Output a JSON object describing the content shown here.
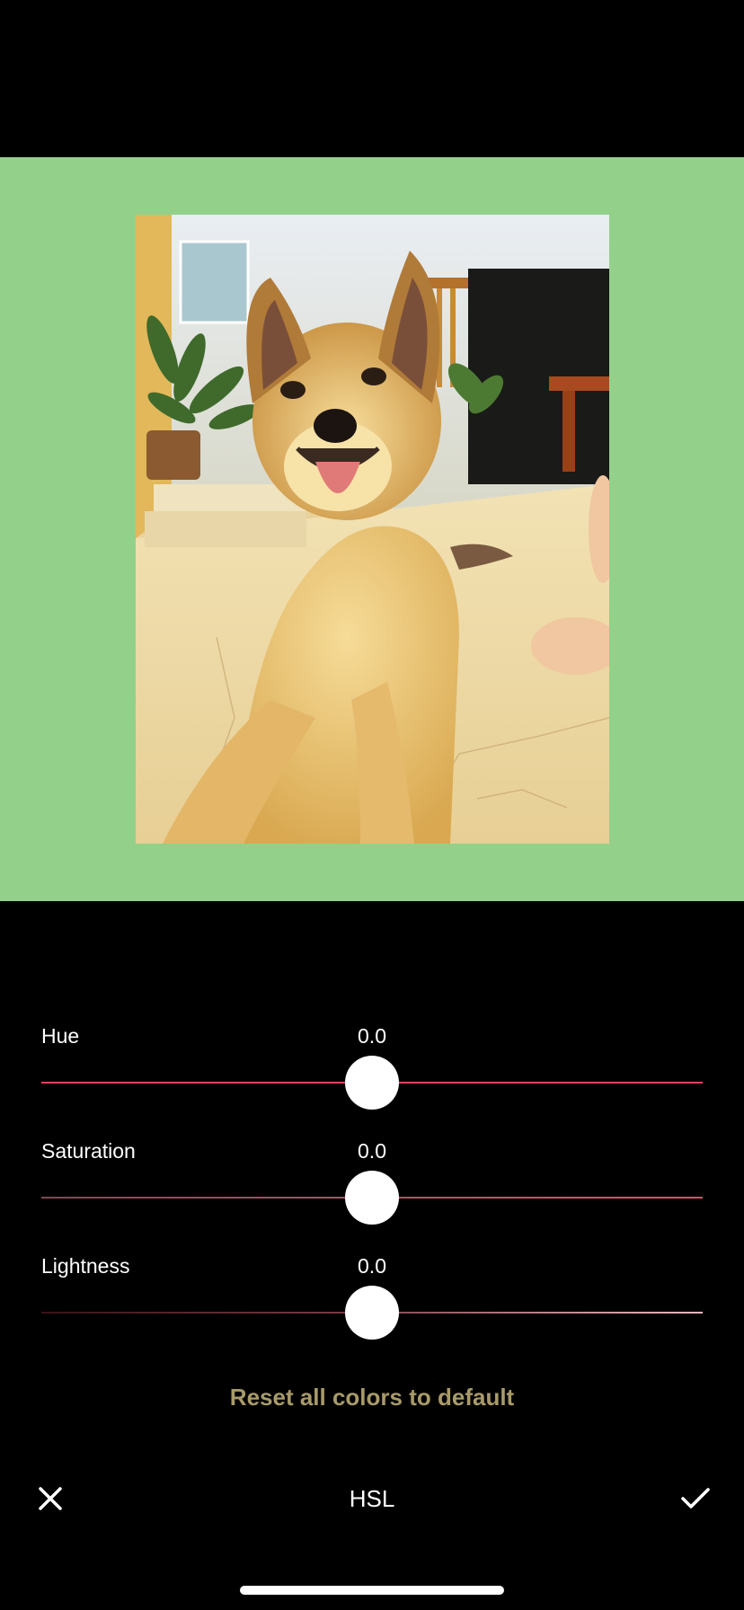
{
  "preview": {
    "background_color": "#93d18b",
    "photo_subject": "dog-photo"
  },
  "sliders": [
    {
      "label": "Hue",
      "value": "0.0",
      "level": 0.5
    },
    {
      "label": "Saturation",
      "value": "0.0",
      "level": 0.5
    },
    {
      "label": "Lightness",
      "value": "0.0",
      "level": 0.5
    }
  ],
  "reset_label": "Reset all colors to default",
  "toolbar": {
    "title": "HSL",
    "cancel_icon": "close-icon",
    "confirm_icon": "checkmark-icon"
  },
  "colors": {
    "reset_text": "#a89a6a",
    "hue_track": "#e0465f"
  }
}
